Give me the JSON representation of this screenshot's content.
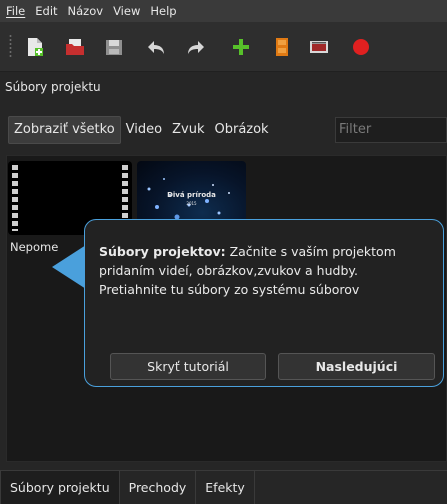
{
  "menubar": {
    "items": [
      {
        "label": "File"
      },
      {
        "label": "Edit"
      },
      {
        "label": "Názov"
      },
      {
        "label": "View"
      },
      {
        "label": "Help"
      }
    ]
  },
  "toolbar": {
    "icons": [
      "new-project-icon",
      "open-project-icon",
      "save-project-icon",
      "undo-icon",
      "redo-icon",
      "add-file-icon",
      "add-track-icon",
      "fullscreen-icon",
      "export-icon"
    ]
  },
  "dock": {
    "title": "Súbory projektu"
  },
  "filter": {
    "buttons": [
      {
        "label": "Zobraziť všetko",
        "active": true
      },
      {
        "label": "Video",
        "active": false
      },
      {
        "label": "Zvuk",
        "active": false
      },
      {
        "label": "Obrázok",
        "active": false
      }
    ],
    "placeholder": "Filter"
  },
  "files": {
    "items": [
      {
        "label": "Nepome"
      },
      {
        "thumbnail_title": "Divá príroda",
        "thumbnail_subtitle": "2015"
      }
    ]
  },
  "tutorial": {
    "heading": "Súbory projektov:",
    "body": " Začnite s vaším projektom pridaním videí, obrázkov,zvukov a hudby. Pretiahnite tu súbory zo systému súborov",
    "hide_label": "Skryť tutoriál",
    "next_label": "Nasledujúci",
    "accent": "#4aa0dc"
  },
  "tabs": [
    {
      "label": "Súbory projektu",
      "active": true
    },
    {
      "label": "Prechody",
      "active": false
    },
    {
      "label": "Efekty",
      "active": false
    }
  ],
  "colors": {
    "record": "#e02020",
    "add": "#57c12a"
  }
}
